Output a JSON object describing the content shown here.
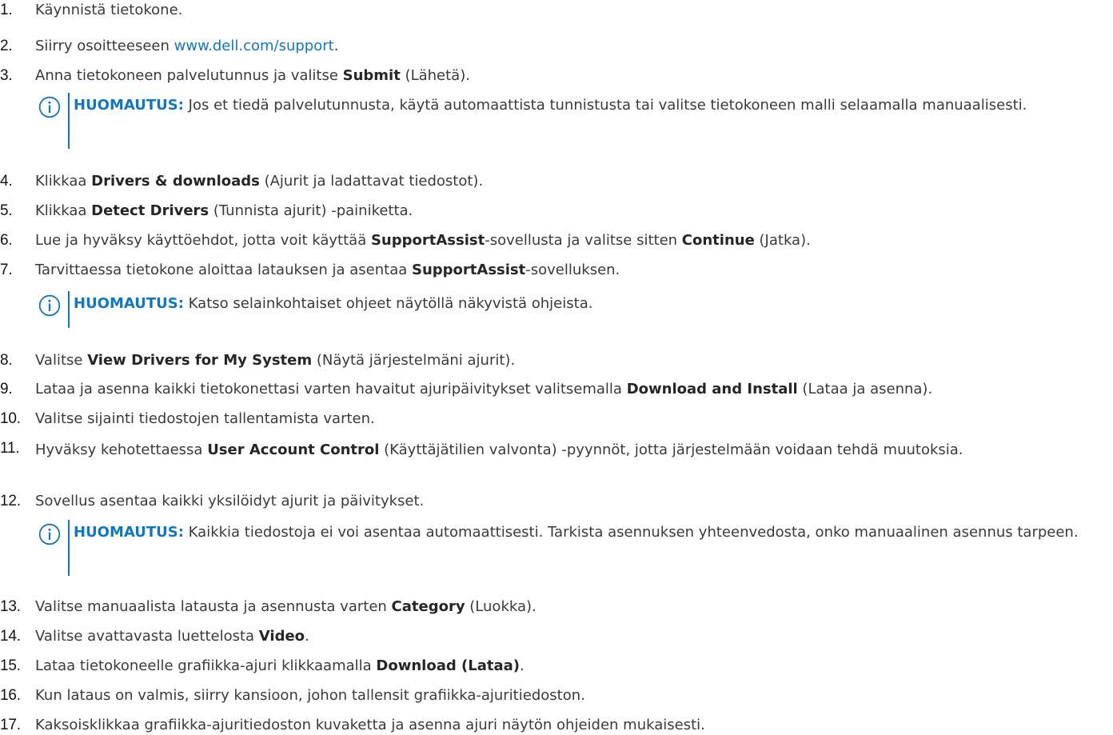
{
  "steps": [
    {
      "num": "1.",
      "parts": [
        {
          "t": "Käynnistä tietokone."
        }
      ]
    },
    {
      "num": "2.",
      "parts": [
        {
          "t": "Siirry osoitteeseen "
        },
        {
          "t": "www.dell.com/support",
          "link": true
        },
        {
          "t": "."
        }
      ]
    },
    {
      "num": "3.",
      "parts": [
        {
          "t": "Anna tietokoneen palvelutunnus ja valitse "
        },
        {
          "t": "Submit",
          "b": true
        },
        {
          "t": " (Lähetä)."
        }
      ]
    },
    {
      "num": "4.",
      "parts": [
        {
          "t": "Klikkaa "
        },
        {
          "t": "Drivers & downloads",
          "b": true
        },
        {
          "t": " (Ajurit ja ladattavat tiedostot)."
        }
      ]
    },
    {
      "num": "5.",
      "parts": [
        {
          "t": "Klikkaa "
        },
        {
          "t": "Detect Drivers",
          "b": true
        },
        {
          "t": " (Tunnista ajurit) -painiketta."
        }
      ]
    },
    {
      "num": "6.",
      "parts": [
        {
          "t": "Lue ja hyväksy käyttöehdot, jotta voit käyttää "
        },
        {
          "t": "SupportAssist",
          "b": true
        },
        {
          "t": "-sovellusta ja valitse sitten "
        },
        {
          "t": "Continue",
          "b": true
        },
        {
          "t": " (Jatka)."
        }
      ]
    },
    {
      "num": "7.",
      "parts": [
        {
          "t": "Tarvittaessa tietokone aloittaa latauksen ja asentaa "
        },
        {
          "t": "SupportAssist",
          "b": true
        },
        {
          "t": "-sovelluksen."
        }
      ]
    },
    {
      "num": "8.",
      "parts": [
        {
          "t": "Valitse "
        },
        {
          "t": "View Drivers for My System",
          "b": true
        },
        {
          "t": " (Näytä järjestelmäni ajurit)."
        }
      ]
    },
    {
      "num": "9.",
      "parts": [
        {
          "t": "Lataa ja asenna kaikki tietokonettasi varten havaitut ajuripäivitykset valitsemalla "
        },
        {
          "t": "Download and Install",
          "b": true
        },
        {
          "t": " (Lataa ja asenna)."
        }
      ]
    },
    {
      "num": "10.",
      "parts": [
        {
          "t": "Valitse sijainti tiedostojen tallentamista varten."
        }
      ]
    },
    {
      "num": "11.",
      "parts": [
        {
          "t": "Hyväksy kehotettaessa "
        },
        {
          "t": "User Account Control",
          "b": true
        },
        {
          "t": " (Käyttäjätilien valvonta) -pyynnöt, jotta järjestelmään voidaan tehdä muutoksia."
        }
      ]
    },
    {
      "num": "12.",
      "parts": [
        {
          "t": "Sovellus asentaa kaikki yksilöidyt ajurit ja päivitykset."
        }
      ]
    },
    {
      "num": "13.",
      "parts": [
        {
          "t": "Valitse manuaalista latausta ja asennusta varten "
        },
        {
          "t": "Category",
          "b": true
        },
        {
          "t": " (Luokka)."
        }
      ]
    },
    {
      "num": "14.",
      "parts": [
        {
          "t": "Valitse avattavasta luettelosta "
        },
        {
          "t": "Video",
          "b": true
        },
        {
          "t": "."
        }
      ]
    },
    {
      "num": "15.",
      "parts": [
        {
          "t": "Lataa tietokoneelle grafiikka-ajuri klikkaamalla "
        },
        {
          "t": "Download (Lataa)",
          "b": true
        },
        {
          "t": "."
        }
      ]
    },
    {
      "num": "16.",
      "parts": [
        {
          "t": "Kun lataus on valmis, siirry kansioon, johon tallensit grafiikka-ajuritiedoston."
        }
      ]
    },
    {
      "num": "17.",
      "parts": [
        {
          "t": "Kaksoisklikkaa grafiikka-ajuritiedoston kuvaketta ja asenna ajuri näytön ohjeiden mukaisesti."
        }
      ]
    }
  ],
  "notes": [
    {
      "label": "HUOMAUTUS:",
      "text": " Jos et tiedä palvelutunnusta, käytä automaattista tunnistusta tai valitse tietokoneen malli selaamalla manuaalisesti."
    },
    {
      "label": "HUOMAUTUS:",
      "text": " Katso selainkohtaiset ohjeet näytöllä näkyvistä ohjeista."
    },
    {
      "label": "HUOMAUTUS:",
      "text": " Kaikkia tiedostoja ei voi asentaa automaattisesti. Tarkista asennuksen yhteenvedosta, onko manuaalinen asennus tarpeen."
    }
  ],
  "colors": {
    "text": "#3a3a3a",
    "accent": "#1377c0",
    "number": "#141414"
  },
  "icons": {
    "note": "info-icon"
  }
}
